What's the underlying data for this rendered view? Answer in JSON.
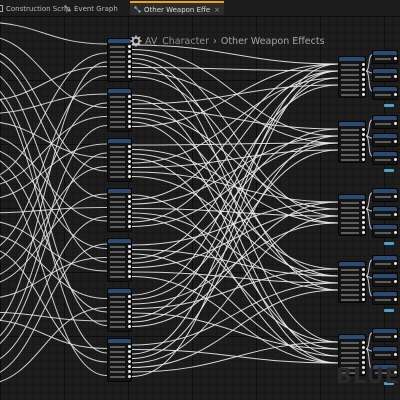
{
  "tabs": [
    {
      "label": "Construction Scrip",
      "icon": "function-icon",
      "active": false
    },
    {
      "label": "Event Graph",
      "icon": "graph-icon",
      "active": false
    },
    {
      "label": "Other Weapon Effe",
      "icon": "graph-icon",
      "active": true,
      "close": "×"
    }
  ],
  "breadcrumb": {
    "root": "AV_Character",
    "separator": "›",
    "current": "Other Weapon Effects"
  },
  "watermark": "BLUE",
  "colors": {
    "wire": "#ececec",
    "node_header": "#2a4b73",
    "tab_accent": "#f0a400",
    "pin_blue": "#7fb8e8"
  }
}
